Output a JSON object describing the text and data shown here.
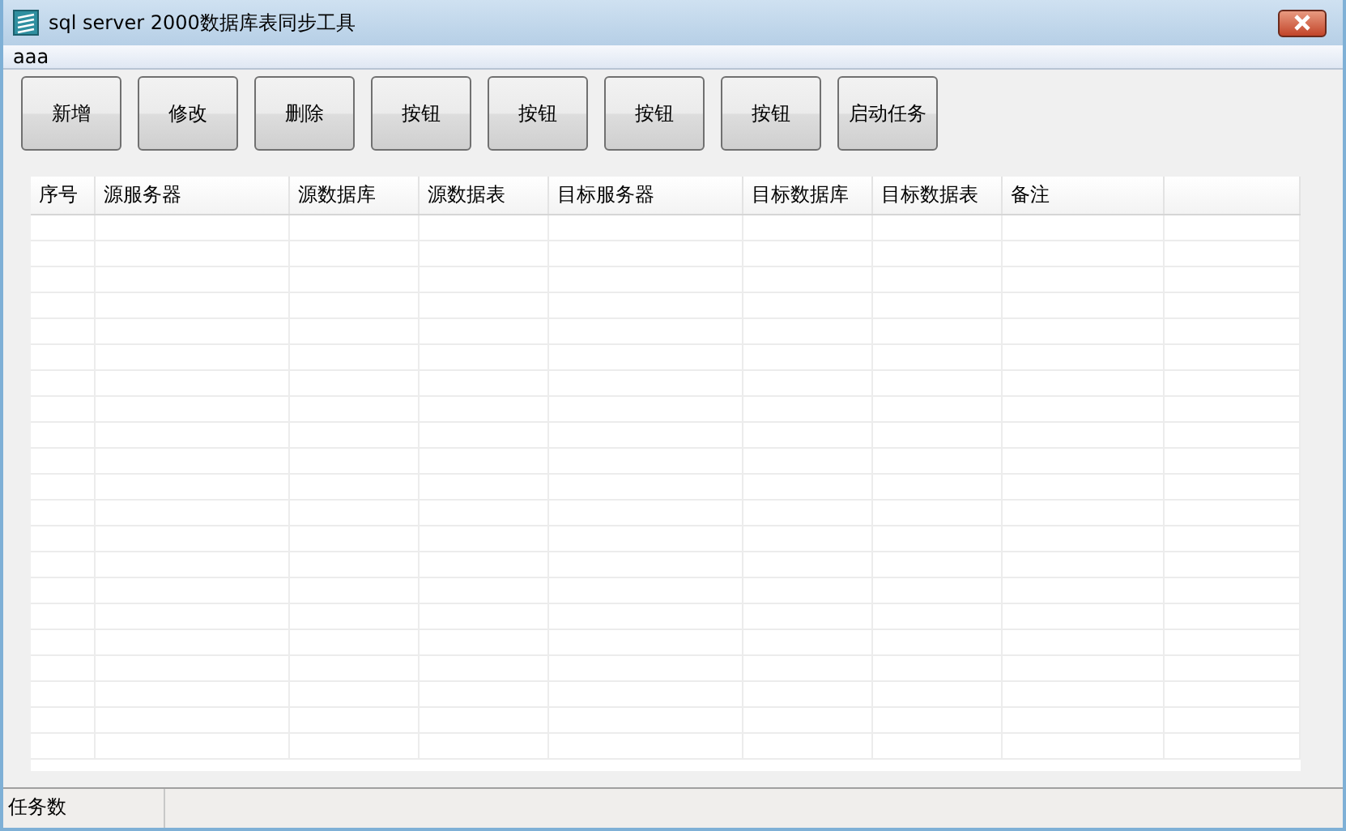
{
  "window": {
    "title": "sql server 2000数据库表同步工具"
  },
  "menu": [
    "aaa"
  ],
  "toolbar": [
    "新增",
    "修改",
    "删除",
    "按钮",
    "按钮",
    "按钮",
    "按钮",
    "启动任务"
  ],
  "table": {
    "columns": [
      "序号",
      "源服务器",
      "源数据库",
      "源数据表",
      "目标服务器",
      "目标数据库",
      "目标数据表",
      "备注"
    ]
  },
  "status_bar": {
    "label": "任务数"
  }
}
